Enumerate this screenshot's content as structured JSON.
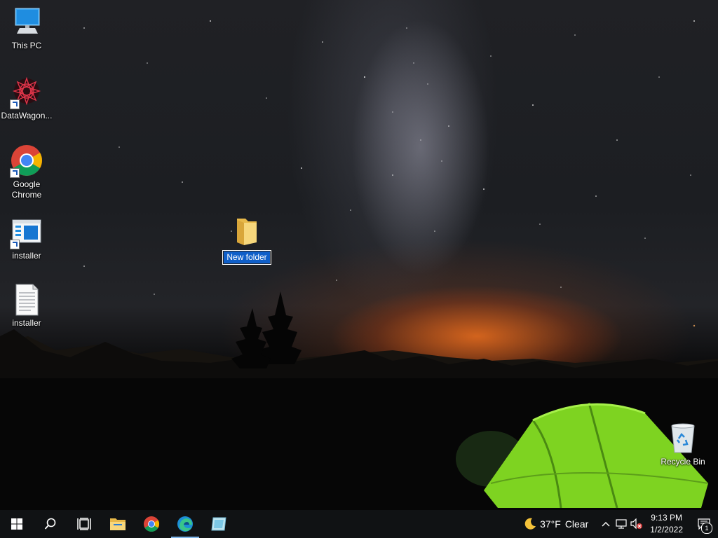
{
  "desktop": {
    "icons": [
      {
        "label": "This PC",
        "icon": "this-pc-icon"
      },
      {
        "label": "DataWagon...",
        "icon": "datawagon-icon"
      },
      {
        "label": "Google Chrome",
        "icon": "chrome-icon"
      },
      {
        "label": "installer",
        "icon": "installer-shortcut-icon"
      },
      {
        "label": "installer",
        "icon": "text-document-icon"
      }
    ],
    "new_folder": {
      "label": "New folder",
      "state": "renaming"
    },
    "recycle_bin": {
      "label": "Recycle Bin",
      "icon": "recycle-bin-icon"
    }
  },
  "taskbar": {
    "pinned": [
      "start-icon",
      "search-icon",
      "task-view-icon",
      "file-explorer-icon",
      "chrome-icon",
      "edge-icon",
      "app-window-icon"
    ],
    "active_app": "edge-icon",
    "tray": {
      "weather_icon": "moon-icon",
      "temperature": "37°F",
      "condition": "Clear",
      "time": "9:13 PM",
      "date": "1/2/2022",
      "notification_count": "1"
    }
  },
  "colors": {
    "selection": "#0f5fc9",
    "taskbar": "#101214",
    "active_indicator": "#7fb5e8"
  }
}
